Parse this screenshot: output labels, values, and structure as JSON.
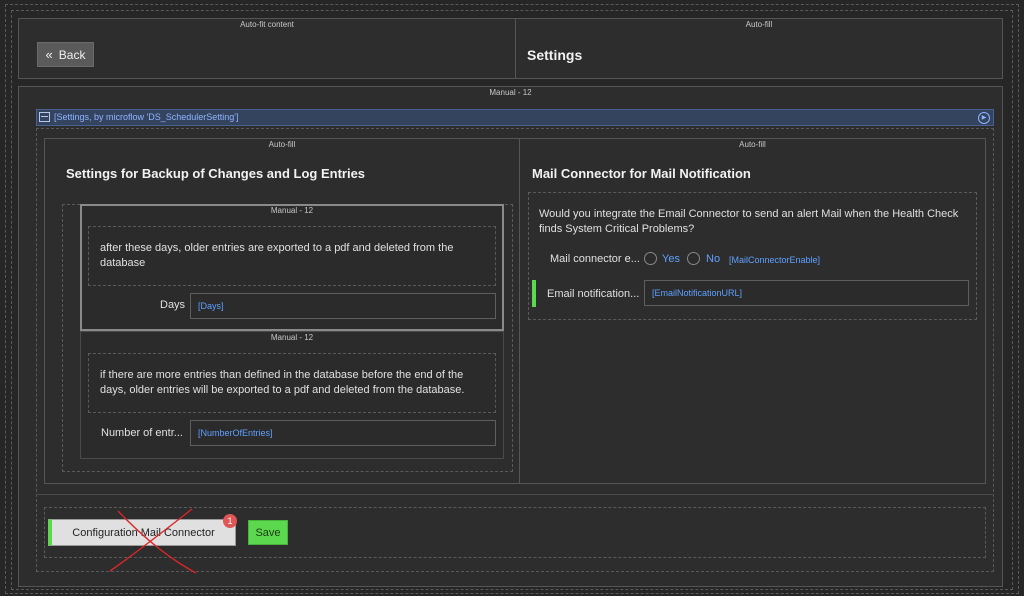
{
  "top": {
    "left_caption": "Auto-fit content",
    "right_caption": "Auto-fill",
    "back_label": "Back",
    "page_title": "Settings"
  },
  "main": {
    "caption": "Manual - 12",
    "dataview_label": "[Settings, by microflow 'DS_SchedulerSetting']",
    "left_col_caption": "Auto-fill",
    "right_col_caption": "Auto-fill"
  },
  "backup": {
    "title": "Settings for Backup of Changes and Log Entries",
    "block1_caption": "Manual - 12",
    "block1_text": "after these days, older entries are exported to a pdf and deleted from the database",
    "days_label": "Days",
    "days_value": "[Days]",
    "block2_caption": "Manual - 12",
    "block2_text": "if there are more entries than defined in the database before the end of the days, older entries will be exported to a pdf and deleted from the database.",
    "entries_label": "Number of entr...",
    "entries_value": "[NumberOfEntries]"
  },
  "mail": {
    "title": "Mail Connector for Mail Notification",
    "question": "Would you integrate the Email Connector to send an alert Mail when the Health Check finds System Critical Problems?",
    "enable_label": "Mail connector e...",
    "yes_label": "Yes",
    "no_label": "No",
    "enable_value": "[MailConnectorEnable]",
    "url_label": "Email notification...",
    "url_value": "[EmailNotificationURL]"
  },
  "footer": {
    "config_button": "Configuration Mail Connector",
    "badge": "1",
    "save_button": "Save"
  },
  "colors": {
    "accent_green": "#5bd84e",
    "badge_red": "#e05656",
    "link_blue": "#5fa0ff",
    "dataview_bar": "#34435e"
  }
}
